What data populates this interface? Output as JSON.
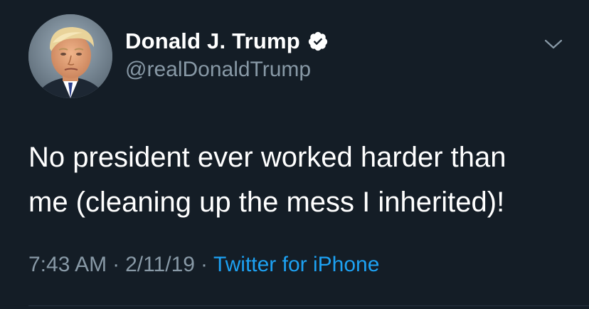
{
  "tweet": {
    "author": {
      "display_name": "Donald J. Trump",
      "handle": "@realDonaldTrump",
      "verified": true
    },
    "text_lines": [
      "No president ever worked harder than",
      "me (cleaning up the mess I inherited)!"
    ],
    "time": "7:43 AM",
    "date": "2/11/19",
    "separator": "·",
    "source": "Twitter for iPhone"
  },
  "icons": {
    "verified": "verified-badge-icon",
    "more": "chevron-down-icon",
    "avatar": "profile-photo"
  },
  "colors": {
    "background": "#141d26",
    "text_primary": "#ffffff",
    "text_secondary": "#8899a6",
    "link": "#1da1f2"
  }
}
